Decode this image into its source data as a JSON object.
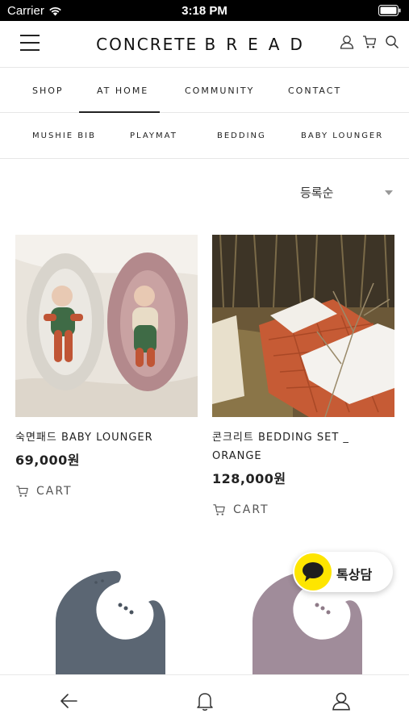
{
  "status_bar": {
    "carrier": "Carrier",
    "time": "3:18 PM"
  },
  "header": {
    "logo_part1": "CONCRETE",
    "logo_part2": "BREAD",
    "icons": [
      "menu-icon",
      "user-icon",
      "cart-icon",
      "search-icon"
    ]
  },
  "nav_primary": {
    "tabs": [
      {
        "label": "SHOP",
        "active": false
      },
      {
        "label": "AT HOME",
        "active": true
      },
      {
        "label": "COMMUNITY",
        "active": false
      },
      {
        "label": "CONTACT",
        "active": false
      }
    ]
  },
  "nav_secondary": {
    "items": [
      {
        "label": "MUSHIE BIB"
      },
      {
        "label": "PLAYMAT"
      },
      {
        "label": "BEDDING"
      },
      {
        "label": "BABY LOUNGER"
      }
    ]
  },
  "sort": {
    "selected": "등록순"
  },
  "products": [
    {
      "name": "숙면패드 BABY LOUNGER",
      "price": "69,000원",
      "cart_label": "CART"
    },
    {
      "name": "콘크리트 BEDDING SET _ ORANGE",
      "price": "128,000원",
      "cart_label": "CART"
    }
  ],
  "chat": {
    "label": "톡상담",
    "color": "#fee500"
  },
  "bottom_bar": {
    "icons": [
      "back-arrow-icon",
      "bell-icon",
      "user-icon"
    ]
  }
}
